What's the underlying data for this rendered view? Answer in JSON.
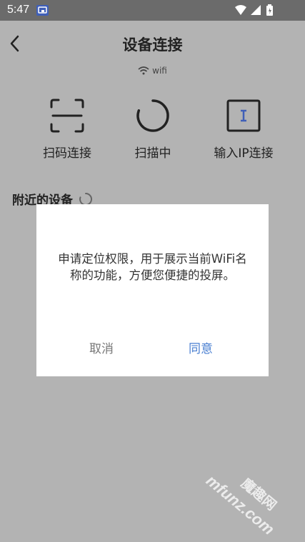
{
  "status_bar": {
    "time": "5:47"
  },
  "header": {
    "title": "设备连接"
  },
  "wifi": {
    "label": "wifi"
  },
  "actions": [
    {
      "label": "扫码连接",
      "icon": "scan-qr-icon"
    },
    {
      "label": "扫描中",
      "icon": "loading-spinner-icon"
    },
    {
      "label": "输入IP连接",
      "icon": "text-input-icon"
    }
  ],
  "nearby": {
    "label": "附近的设备"
  },
  "dialog": {
    "message": "申请定位权限，用于展示当前WiFi名称的功能，方便您便捷的投屏。",
    "cancel_label": "取消",
    "agree_label": "同意"
  },
  "watermark": {
    "text": "mfunz.com",
    "text_cn": "魔趣网"
  },
  "colors": {
    "accent": "#4a7fd1",
    "icon": "#222222",
    "status_bar": "#6b6b6b",
    "overlay": "#b3b3b3"
  }
}
